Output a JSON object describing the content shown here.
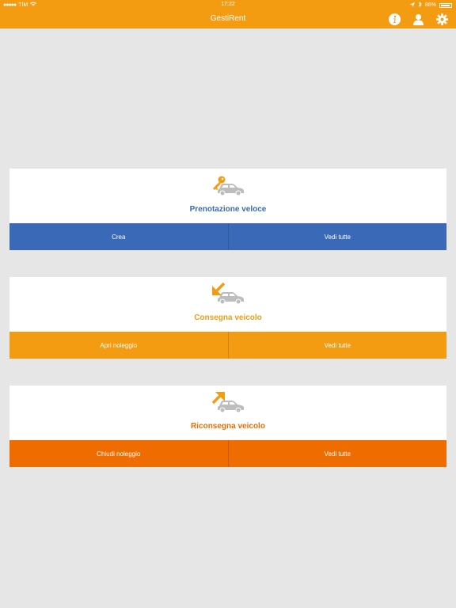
{
  "status_bar": {
    "carrier": "TIM",
    "time": "17:22",
    "battery": "86%"
  },
  "navbar": {
    "title": "GestiRent",
    "icons": [
      "info-icon",
      "user-icon",
      "gear-icon"
    ]
  },
  "cards": [
    {
      "title": "Prenotazione veloce",
      "title_color": "#3a6ab7",
      "icon": "key-car-icon",
      "button_color": "#3a6ab7",
      "buttons": [
        "Crea",
        "Vedi tutte"
      ]
    },
    {
      "title": "Consegna veicolo",
      "title_color": "#f39c12",
      "icon": "arrow-in-car-icon",
      "button_color": "#f39c12",
      "buttons": [
        "Apri noleggio",
        "Vedi tutte"
      ]
    },
    {
      "title": "Riconsegna veicolo",
      "title_color": "#ef6c00",
      "icon": "arrow-out-car-icon",
      "button_color": "#ef6c00",
      "buttons": [
        "Chiudi noleggio",
        "Vedi tutte"
      ]
    }
  ]
}
